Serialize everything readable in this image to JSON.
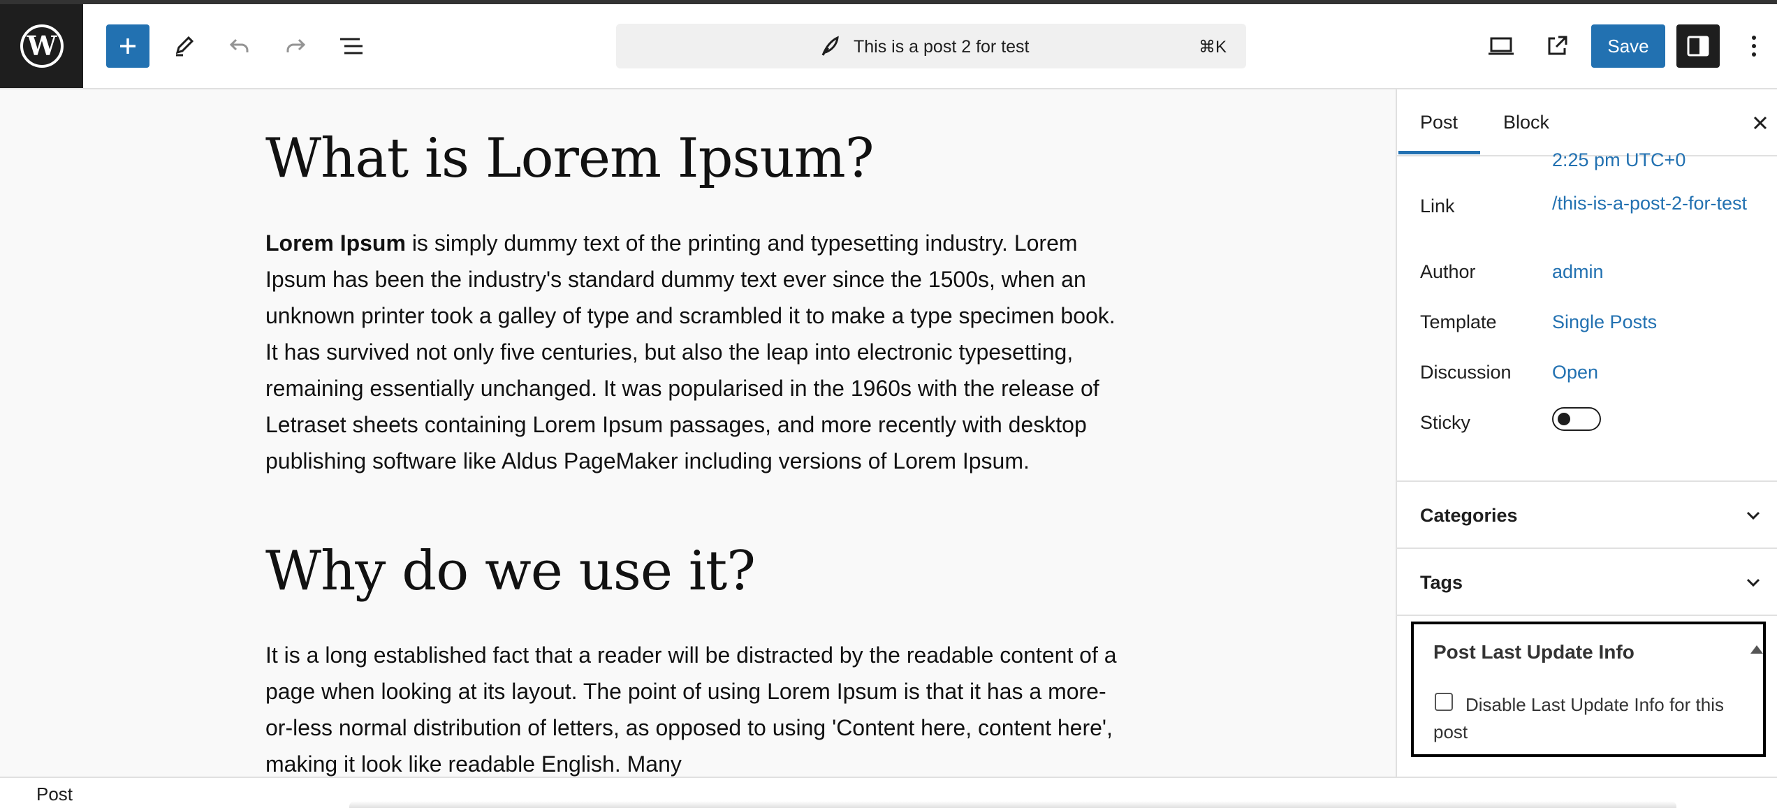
{
  "header": {
    "document_title": "This is a post 2 for test",
    "shortcut": "⌘K",
    "save_label": "Save"
  },
  "content": {
    "heading_1": "What is Lorem Ipsum?",
    "para_1_bold": "Lorem Ipsum",
    "para_1_rest": " is simply dummy text of the printing and typesetting industry. Lorem Ipsum has been the industry's standard dummy text ever since the 1500s, when an unknown printer took a galley of type and scrambled it to make a type specimen book. It has survived not only five centuries, but also the leap into electronic typesetting, remaining essentially unchanged. It was popularised in the 1960s with the release of Letraset sheets containing Lorem Ipsum passages, and more recently with desktop publishing software like Aldus PageMaker including versions of Lorem Ipsum.",
    "heading_2": "Why do we use it?",
    "para_2": "It is a long established fact that a reader will be distracted by the readable content of a page when looking at its layout. The point of using Lorem Ipsum is that it has a more-or-less normal distribution of letters, as opposed to using 'Content here, content here', making it look like readable English. Many"
  },
  "sidebar": {
    "tabs": [
      "Post",
      "Block"
    ],
    "time_value": "2:25 pm UTC+0",
    "rows": {
      "link_label": "Link",
      "link_value": "/this-is-a-post-2-for-test",
      "author_label": "Author",
      "author_value": "admin",
      "template_label": "Template",
      "template_value": "Single Posts",
      "discussion_label": "Discussion",
      "discussion_value": "Open",
      "sticky_label": "Sticky"
    },
    "sticky_on": false,
    "panels": {
      "categories": "Categories",
      "tags": "Tags"
    },
    "meta_box": {
      "title": "Post Last Update Info",
      "checkbox_label": "Disable Last Update Info for this post",
      "checked": false
    }
  },
  "footer": {
    "breadcrumb": "Post"
  },
  "colors": {
    "accent": "#2271b1",
    "dark": "#1e1e1e"
  }
}
